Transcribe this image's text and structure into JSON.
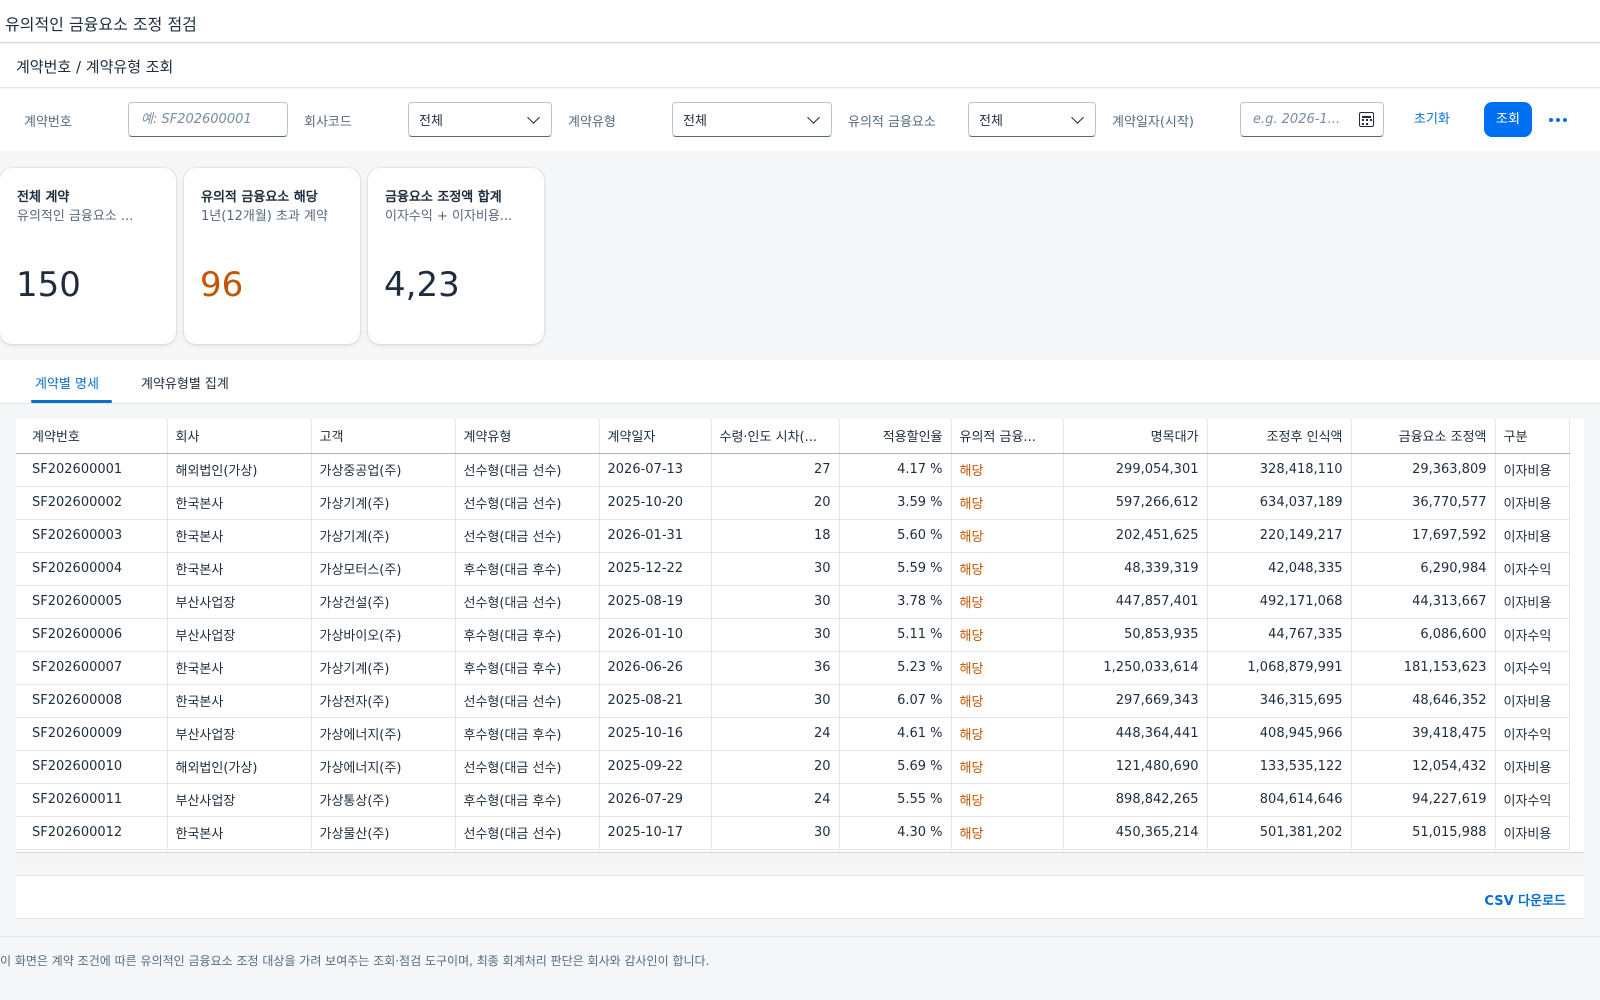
{
  "app": {
    "title": "유의적인 금융요소 조정 점검"
  },
  "header": {
    "title": "계약번호 / 계약유형 조회"
  },
  "filters": {
    "contract_no_label": "계약번호",
    "contract_no_placeholder": "예: SF202600001",
    "company_label": "회사코드",
    "company_value": "전체",
    "type_label": "계약유형",
    "type_value": "전체",
    "significant_label": "유의적 금융요소",
    "significant_value": "전체",
    "date_label": "계약일자(시작)",
    "date_placeholder": "e.g. 2026-1...",
    "reset_label": "초기화",
    "go_label": "조회"
  },
  "cards": [
    {
      "title": "전체 계약",
      "subtitle": "유의적인 금융요소 ...",
      "value": "150"
    },
    {
      "title": "유의적 금융요소 해당",
      "subtitle": "1년(12개월) 초과 계약",
      "value": "96"
    },
    {
      "title": "금융요소 조정액 합계",
      "subtitle": "이자수익 + 이자비용...",
      "value": "4,23"
    }
  ],
  "tabs": [
    {
      "label": "계약별 명세",
      "active": true
    },
    {
      "label": "계약유형별 집계",
      "active": false
    }
  ],
  "table": {
    "columns": [
      "계약번호",
      "회사",
      "고객",
      "계약유형",
      "계약일자",
      "수령·인도 시차(...",
      "적용할인율",
      "유의적 금융...",
      "명목대가",
      "조정후 인식액",
      "금융요소 조정액",
      "구분"
    ],
    "rows": [
      [
        "SF202600001",
        "해외법인(가상)",
        "가상중공업(주)",
        "선수형(대금 선수)",
        "2026-07-13",
        "27",
        "4.17 %",
        "해당",
        "299,054,301",
        "328,418,110",
        "29,363,809",
        "이자비용"
      ],
      [
        "SF202600002",
        "한국본사",
        "가상기계(주)",
        "선수형(대금 선수)",
        "2025-10-20",
        "20",
        "3.59 %",
        "해당",
        "597,266,612",
        "634,037,189",
        "36,770,577",
        "이자비용"
      ],
      [
        "SF202600003",
        "한국본사",
        "가상기계(주)",
        "선수형(대금 선수)",
        "2026-01-31",
        "18",
        "5.60 %",
        "해당",
        "202,451,625",
        "220,149,217",
        "17,697,592",
        "이자비용"
      ],
      [
        "SF202600004",
        "한국본사",
        "가상모터스(주)",
        "후수형(대금 후수)",
        "2025-12-22",
        "30",
        "5.59 %",
        "해당",
        "48,339,319",
        "42,048,335",
        "6,290,984",
        "이자수익"
      ],
      [
        "SF202600005",
        "부산사업장",
        "가상건설(주)",
        "선수형(대금 선수)",
        "2025-08-19",
        "30",
        "3.78 %",
        "해당",
        "447,857,401",
        "492,171,068",
        "44,313,667",
        "이자비용"
      ],
      [
        "SF202600006",
        "부산사업장",
        "가상바이오(주)",
        "후수형(대금 후수)",
        "2026-01-10",
        "30",
        "5.11 %",
        "해당",
        "50,853,935",
        "44,767,335",
        "6,086,600",
        "이자수익"
      ],
      [
        "SF202600007",
        "한국본사",
        "가상기계(주)",
        "후수형(대금 후수)",
        "2026-06-26",
        "36",
        "5.23 %",
        "해당",
        "1,250,033,614",
        "1,068,879,991",
        "181,153,623",
        "이자수익"
      ],
      [
        "SF202600008",
        "한국본사",
        "가상전자(주)",
        "선수형(대금 선수)",
        "2025-08-21",
        "30",
        "6.07 %",
        "해당",
        "297,669,343",
        "346,315,695",
        "48,646,352",
        "이자비용"
      ],
      [
        "SF202600009",
        "부산사업장",
        "가상에너지(주)",
        "후수형(대금 후수)",
        "2025-10-16",
        "24",
        "4.61 %",
        "해당",
        "448,364,441",
        "408,945,966",
        "39,418,475",
        "이자수익"
      ],
      [
        "SF202600010",
        "해외법인(가상)",
        "가상에너지(주)",
        "선수형(대금 선수)",
        "2025-09-22",
        "20",
        "5.69 %",
        "해당",
        "121,480,690",
        "133,535,122",
        "12,054,432",
        "이자비용"
      ],
      [
        "SF202600011",
        "부산사업장",
        "가상통상(주)",
        "후수형(대금 후수)",
        "2026-07-29",
        "24",
        "5.55 %",
        "해당",
        "898,842,265",
        "804,614,646",
        "94,227,619",
        "이자수익"
      ],
      [
        "SF202600012",
        "한국본사",
        "가상물산(주)",
        "선수형(대금 선수)",
        "2025-10-17",
        "30",
        "4.30 %",
        "해당",
        "450,365,214",
        "501,381,202",
        "51,015,988",
        "이자비용"
      ]
    ]
  },
  "footer": {
    "csv_label": "CSV 다운로드",
    "note": "이 화면은 계약 조건에 따른 유의적인 금융요소 조정 대상을 가려 보여주는 조회·점검 도구이며, 최종 회계처리 판단은 회사와 감사인이 합니다."
  },
  "colors": {
    "accent": "#0070f2",
    "link": "#0a6ed1",
    "warning": "#c35500"
  }
}
